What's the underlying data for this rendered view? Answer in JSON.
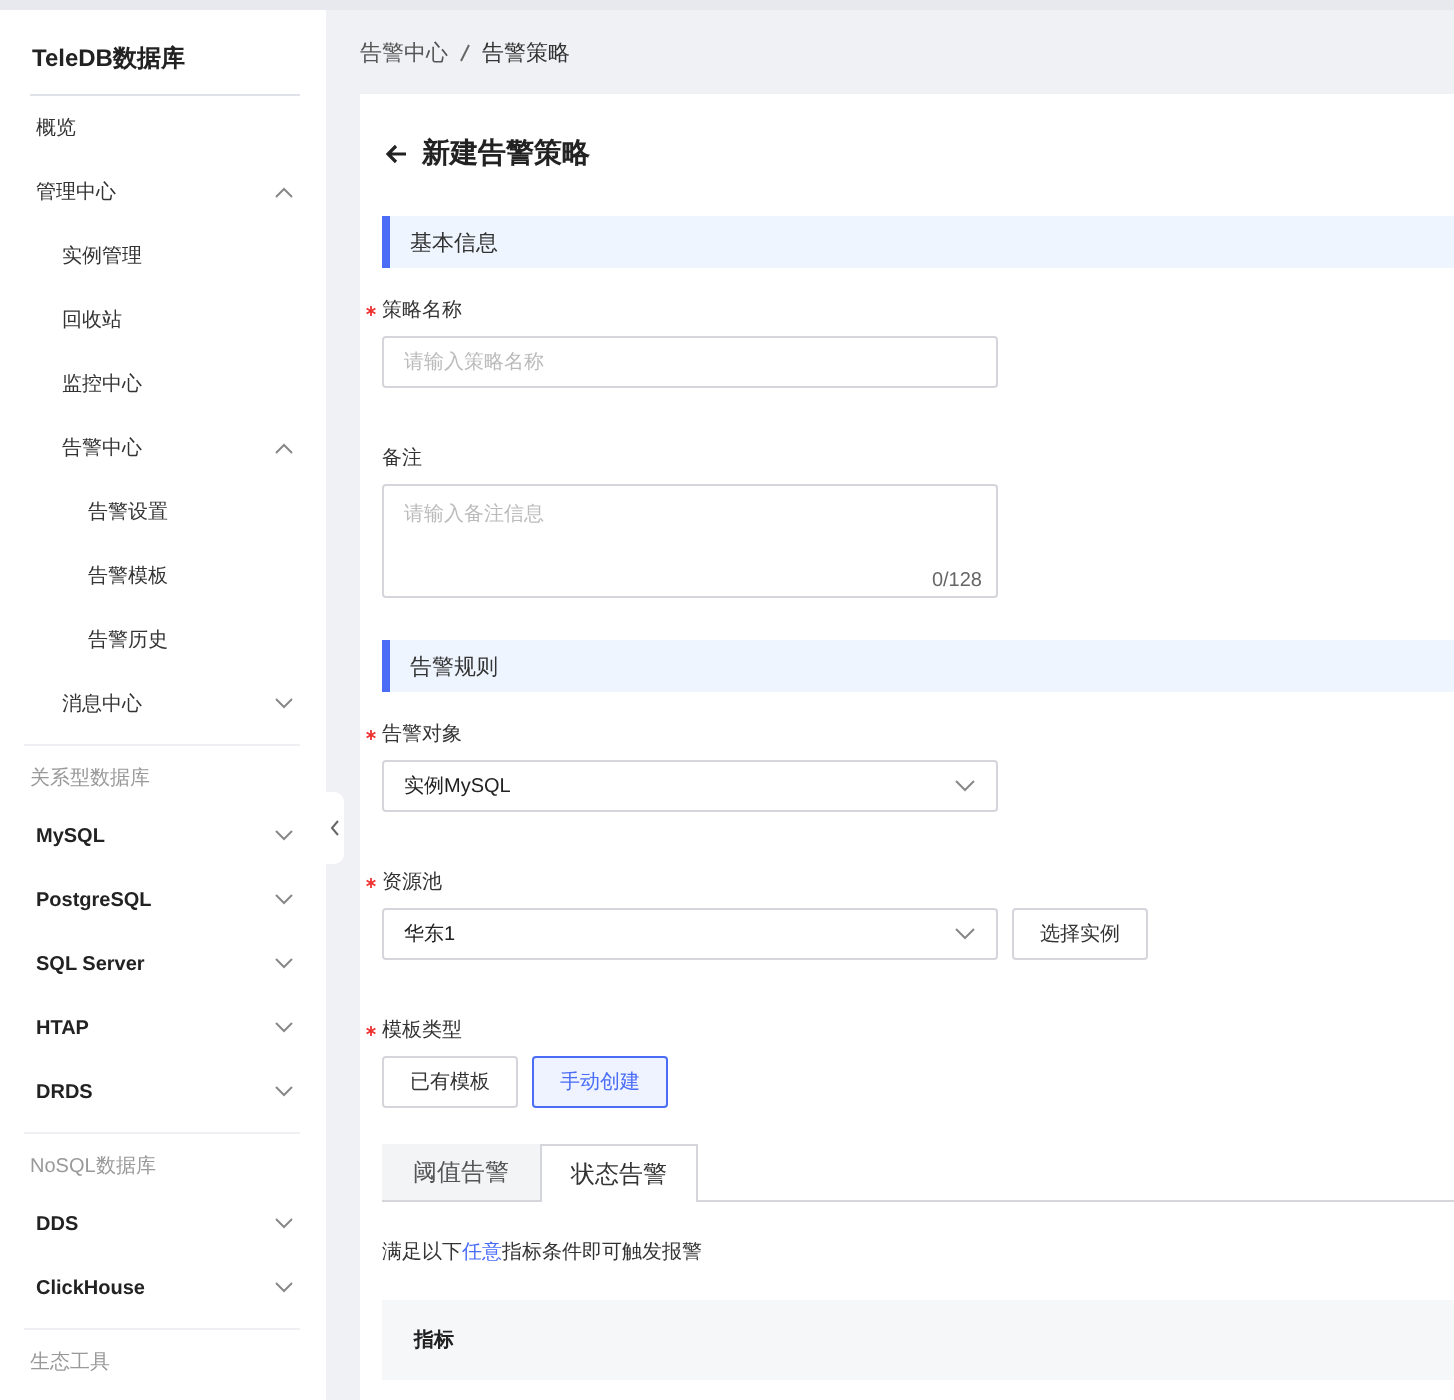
{
  "sidebar": {
    "title": "TeleDB数据库",
    "sections": [
      {
        "items": [
          {
            "label": "概览"
          },
          {
            "label": "管理中心",
            "expanded": true,
            "children": [
              {
                "label": "实例管理"
              },
              {
                "label": "回收站"
              },
              {
                "label": "监控中心"
              },
              {
                "label": "告警中心",
                "expanded": true,
                "children": [
                  {
                    "label": "告警设置"
                  },
                  {
                    "label": "告警模板"
                  },
                  {
                    "label": "告警历史"
                  }
                ]
              },
              {
                "label": "消息中心",
                "expanded": false
              }
            ]
          }
        ]
      },
      {
        "heading": "关系型数据库",
        "items": [
          {
            "label": "MySQL",
            "expanded": false
          },
          {
            "label": "PostgreSQL",
            "expanded": false
          },
          {
            "label": "SQL Server",
            "expanded": false
          },
          {
            "label": "HTAP",
            "expanded": false
          },
          {
            "label": "DRDS",
            "expanded": false
          }
        ]
      },
      {
        "heading": "NoSQL数据库",
        "items": [
          {
            "label": "DDS",
            "expanded": false
          },
          {
            "label": "ClickHouse",
            "expanded": false
          }
        ]
      },
      {
        "heading": "生态工具"
      }
    ]
  },
  "breadcrumb": [
    "告警中心",
    "告警策略"
  ],
  "page_title": "新建告警策略",
  "sections": [
    {
      "title": "基本信息",
      "fields": [
        {
          "kind": "input",
          "label": "策略名称",
          "required": true,
          "placeholder": "请输入策略名称"
        },
        {
          "kind": "textarea",
          "label": "备注",
          "required": false,
          "placeholder": "请输入备注信息",
          "counter": "0/128"
        }
      ]
    },
    {
      "title": "告警规则",
      "fields": [
        {
          "kind": "select",
          "label": "告警对象",
          "required": true,
          "value": "实例MySQL"
        },
        {
          "kind": "select",
          "label": "资源池",
          "required": true,
          "value": "华东1",
          "button": "选择实例"
        },
        {
          "kind": "choice",
          "label": "模板类型",
          "required": true,
          "options": [
            {
              "label": "已有模板",
              "selected": false
            },
            {
              "label": "手动创建",
              "selected": true
            }
          ]
        }
      ]
    }
  ],
  "tabs": [
    {
      "label": "阈值告警",
      "selected": false
    },
    {
      "label": "状态告警",
      "selected": true
    }
  ],
  "condition": {
    "before": "满足以下",
    "link": "任意",
    "after": "指标条件即可触发报警"
  },
  "table": {
    "columns": [
      "指标"
    ]
  }
}
